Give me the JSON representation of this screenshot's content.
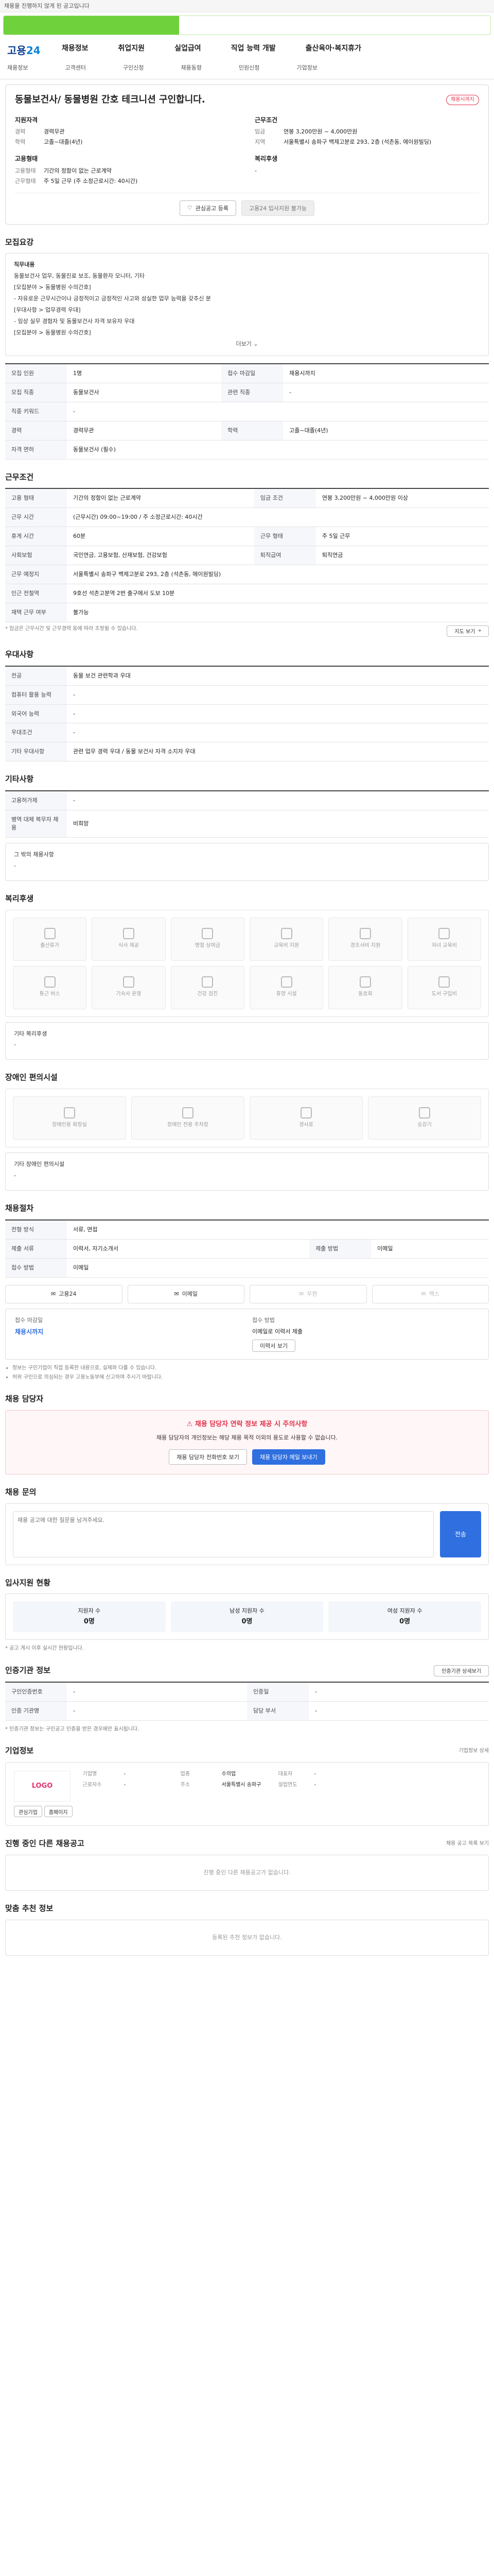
{
  "topbar": {
    "text": "채용을 진행하지 않게 된 공고입니다"
  },
  "progress": {
    "label": "",
    "percent": 36
  },
  "header": {
    "logo_main": "고용",
    "logo_accent": "24",
    "nav": [
      "채용정보",
      "취업지원",
      "실업급여",
      "직업 능력 개발",
      "출산육아·복지휴가"
    ],
    "subnav": [
      "채용정보",
      "고객센터",
      "구인신청",
      "채용동향",
      "민원신청",
      "기업정보"
    ]
  },
  "summary": {
    "title": "동물보건사/ 동물병원 간호 테크니션 구인합니다.",
    "badge": "채용시까지",
    "qual_head": "지원자격",
    "qual": [
      {
        "k": "경력",
        "v": "경력무관"
      },
      {
        "k": "학력",
        "v": "고졸~대졸(4년)"
      }
    ],
    "cond_head": "근무조건",
    "cond": [
      {
        "k": "임금",
        "v": "연봉 3,200만원 ~ 4,000만원"
      },
      {
        "k": "지역",
        "v": "서울특별시 송파구 백제고분로 293, 2층 (석촌동, 에이원빌딩)"
      }
    ],
    "emp_head": "고용형태",
    "emp": [
      {
        "k": "고용형태",
        "v": "기간의 정함이 없는 근로계약"
      },
      {
        "k": "근무형태",
        "v": "주 5일 근무 (주 소정근로시간: 40시간)"
      }
    ],
    "welfare_head": "복리후생",
    "welfare_value": "-",
    "btn_interest": "관심공고 등록",
    "btn_apply": "고용24 입사지원 불가능"
  },
  "recruit": {
    "heading": "모집요강",
    "duty_head": "직무내용",
    "duty_lines": [
      "동물보건사 업무, 동물진료 보조, 동물환자 모니터, 기타",
      "[모집분야 > 동물병원 수의간호]",
      "- 자유로운 근무시간이나 긍정적이고 긍정적인 사고와 성실한 업무 능력을 갖추신 분",
      "[우대사항 > 업무경력 우대]",
      "- 임상 실무 경험자 및 동물보건사 자격 보유자 우대",
      "[모집분야 > 동물병원 수의간호]"
    ],
    "more": "더보기",
    "rows": [
      {
        "k1": "모집 인원",
        "v1": "1명",
        "k2": "접수 마감일",
        "v2": "채용시까지"
      },
      {
        "k1": "모집 직종",
        "v1": "동물보건사",
        "k2": "관련 직종",
        "v2": "-"
      },
      {
        "k1": "직종 키워드",
        "v1": "-",
        "k2": "",
        "v2": ""
      },
      {
        "k1": "경력",
        "v1": "경력무관",
        "k2": "학력",
        "v2": "고졸~대졸(4년)"
      },
      {
        "k1": "자격 면허",
        "v1": "동물보건사 (필수)",
        "k2": "",
        "v2": ""
      }
    ]
  },
  "work": {
    "heading": "근무조건",
    "rows": [
      {
        "k1": "고용 형태",
        "v1": "기간의 정함이 없는 근로계약",
        "k2": "임금 조건",
        "v2": "연봉 3,200만원 ~ 4,000만원 이상"
      },
      {
        "k1": "근무 시간",
        "v1": "(근무시간) 09:00~19:00 / 주 소정근로시간: 40시간",
        "k2": "",
        "v2": ""
      },
      {
        "k1": "휴게 시간",
        "v1": "60분",
        "k2": "근무 형태",
        "v2": "주 5일 근무"
      },
      {
        "k1": "사회보험",
        "v1": "국민연금, 고용보험, 산재보험, 건강보험",
        "k2": "퇴직급여",
        "v2": "퇴직연금"
      },
      {
        "k1": "근무 예정지",
        "v1": "서울특별시 송파구 백제고분로 293, 2층 (석촌동, 에이원빌딩)",
        "k2": "",
        "v2": ""
      },
      {
        "k1": "인근 전철역",
        "v1": "9호선 석촌고분역 2번 출구에서 도보 10분",
        "k2": "",
        "v2": ""
      },
      {
        "k1": "재택 근무 여부",
        "v1": "불가능",
        "k2": "",
        "v2": ""
      }
    ],
    "map_btn": "지도 보기",
    "note": "* 임금은 근무시간 및 근무경력 등에 따라 조정될 수 있습니다."
  },
  "prefer": {
    "heading": "우대사항",
    "rows": [
      {
        "k": "전공",
        "v": "동물 보건 관련학과 우대"
      },
      {
        "k": "컴퓨터 활용 능력",
        "v": "-"
      },
      {
        "k": "외국어 능력",
        "v": "-"
      },
      {
        "k": "우대조건",
        "v": "-"
      },
      {
        "k": "기타 우대사항",
        "v": "관련 업무 경력 우대 / 동물 보건사 자격 소지자 우대"
      }
    ]
  },
  "other": {
    "heading": "기타사항",
    "rows": [
      {
        "k": "고용허가제",
        "v": "-"
      },
      {
        "k": "병역 대체 복무자 채용",
        "v": "비희망"
      }
    ],
    "etc": "그 밖의 채용사항",
    "etc_value": "-"
  },
  "welfare": {
    "heading": "복리후생",
    "items": [
      "출산휴가",
      "식사 제공",
      "명절 상여금",
      "교육비 지원",
      "경조사비 지원",
      "자녀 교육비",
      "통근 버스",
      "기숙사 운영",
      "건강 검진",
      "휴양 시설",
      "동호회",
      "도서 구입비"
    ],
    "extra_head": "기타 복리후생",
    "extra_value": "-"
  },
  "disabled": {
    "heading": "장애인 편의시설",
    "items": [
      "장애인용 화장실",
      "장애인 전용 주차장",
      "경사로",
      "승강기"
    ],
    "extra_head": "기타 장애인 편의시설",
    "extra_value": "-"
  },
  "screening": {
    "heading": "채용절차",
    "rows": [
      {
        "k1": "전형 방식",
        "v1": "서류, 면접",
        "k2": "",
        "v2": ""
      },
      {
        "k1": "제출 서류",
        "v1": "이력서, 자기소개서",
        "k2": "제출 방법",
        "v2": "이메일"
      },
      {
        "k1": "접수 방법",
        "v1": "이메일",
        "k2": "",
        "v2": ""
      }
    ],
    "methods": [
      "고용24",
      "이메일",
      "우편",
      "팩스"
    ],
    "deadline_head": "접수 마감일",
    "deadline_value": "채용시까지",
    "apply_head": "접수 방법",
    "apply_value": "이메일로 이력서 제출",
    "apply_btn": "이력서 보기",
    "notes": [
      "정보는 구인기업이 직접 등록한 내용으로, 실제와 다를 수 있습니다.",
      "허위 구인으로 의심되는 경우 고용노동부에 신고하여 주시기 바랍니다."
    ]
  },
  "contact": {
    "heading": "채용 담당자",
    "alert_title": "채용 담당자 연락 정보 제공 시 주의사항",
    "alert_text": "채용 담당자의 개인정보는 해당 채용 목적 이외의 용도로 사용할 수 없습니다.",
    "btn_call": "채용 담당자 전화번호 보기",
    "btn_mail": "채용 담당자 메일 보내기"
  },
  "inquiry": {
    "heading": "채용 문의",
    "placeholder": "채용 공고에 대한 질문을 남겨주세요.",
    "send": "전송"
  },
  "stats": {
    "heading": "입사지원 현황",
    "items": [
      {
        "label": "지원자 수",
        "value": "0명"
      },
      {
        "label": "남성 지원자 수",
        "value": "0명"
      },
      {
        "label": "여성 지원자 수",
        "value": "0명"
      }
    ],
    "note": "* 공고 게시 이후 실시간 현황입니다."
  },
  "agency": {
    "heading": "인증기관 정보",
    "rows": [
      {
        "k1": "구인인증번호",
        "v1": "-",
        "k2": "인증일",
        "v2": "-"
      },
      {
        "k1": "인증 기관명",
        "v1": "-",
        "k2": "담당 부서",
        "v2": "-"
      }
    ],
    "btn": "인증기관 상세보기",
    "note": "* 인증기관 정보는 구인공고 인증을 받은 경우에만 표시됩니다."
  },
  "company": {
    "heading": "기업정보",
    "more": "기업정보 상세",
    "logo_text": "LOGO",
    "kv": [
      {
        "k": "기업명",
        "v": "-"
      },
      {
        "k": "업종",
        "v": "수의업"
      },
      {
        "k": "대표자",
        "v": "-"
      },
      {
        "k": "근로자수",
        "v": "-"
      },
      {
        "k": "주소",
        "v": "서울특별시 송파구"
      },
      {
        "k": "설립연도",
        "v": "-"
      }
    ],
    "btn_interest": "관심기업",
    "btn_site": "홈페이지"
  },
  "others": {
    "heading": "진행 중인 다른 채용공고",
    "empty": "진행 중인 다른 채용공고가 없습니다.",
    "link": "채용 공고 목록 보기"
  },
  "recommend": {
    "heading": "맞춤 추천 정보",
    "empty": "등록된 추천 정보가 없습니다."
  }
}
